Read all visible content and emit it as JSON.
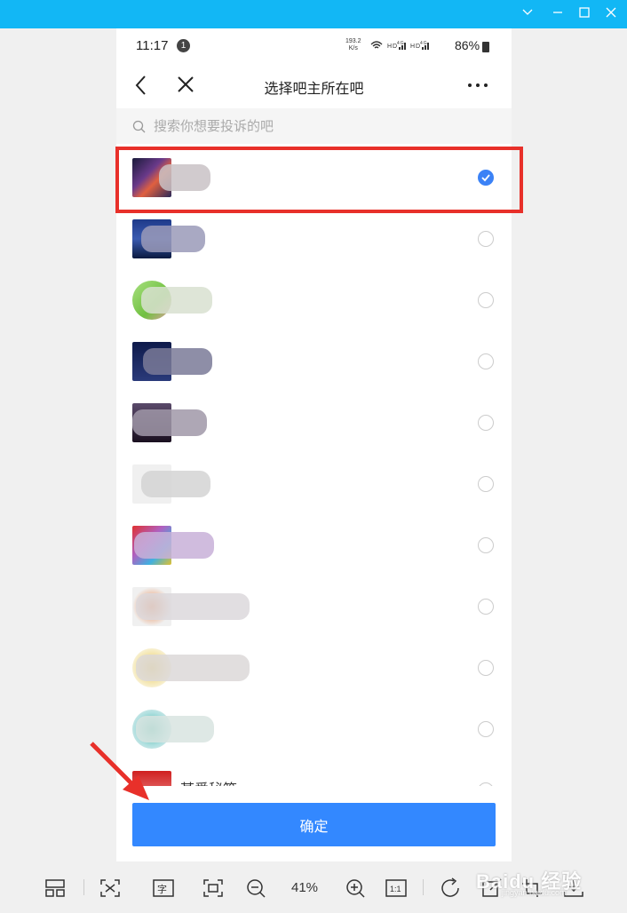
{
  "window": {
    "controls": [
      "chevron-down",
      "minimize",
      "maximize",
      "close"
    ]
  },
  "status_bar": {
    "time": "11:17",
    "notification_count": "1",
    "net_speed": "193.2\nK/s",
    "signal_text": "HD 4G HD 4G",
    "battery": "86%"
  },
  "nav": {
    "title": "选择吧主所在吧"
  },
  "search": {
    "placeholder": "搜索你想要投诉的吧"
  },
  "list": {
    "items": [
      {
        "label": "",
        "checked": true,
        "avatar_color": "#3a3a6a"
      },
      {
        "label": "",
        "checked": false,
        "avatar_color": "#2c4a8c"
      },
      {
        "label": "",
        "checked": false,
        "avatar_color": "#8ccf5a"
      },
      {
        "label": "",
        "checked": false,
        "avatar_color": "#1e2a5c"
      },
      {
        "label": "",
        "checked": false,
        "avatar_color": "#3b3044"
      },
      {
        "label": "",
        "checked": false,
        "avatar_color": "#eeeeee"
      },
      {
        "label": "",
        "checked": false,
        "avatar_color": "#c83a3a"
      },
      {
        "label": "",
        "checked": false,
        "avatar_color": "#e87a3a"
      },
      {
        "label": "",
        "checked": false,
        "avatar_color": "#e8c84a"
      },
      {
        "label": "",
        "checked": false,
        "avatar_color": "#3ab0a0"
      },
      {
        "label": "某爱秘笈",
        "checked": false,
        "avatar_color": "#d02020"
      }
    ]
  },
  "confirm_button": {
    "label": "确定"
  },
  "viewer_toolbar": {
    "zoom": "41%",
    "actual_size": "1:1"
  },
  "watermark": {
    "text": "Baidu 经验",
    "sub": "jingyan.baidu.com"
  },
  "colors": {
    "accent": "#3388ff",
    "highlight": "#e8302a",
    "titlebar": "#12b7f5"
  }
}
